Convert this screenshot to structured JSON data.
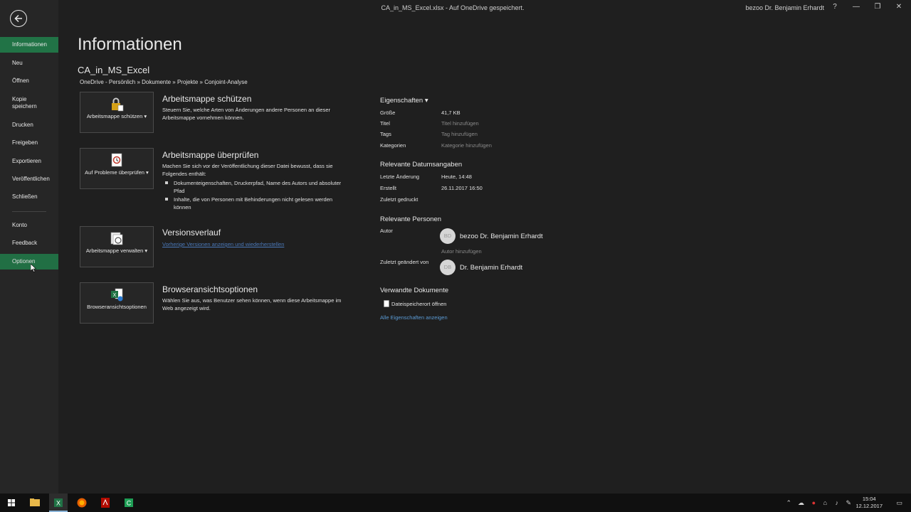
{
  "titlebar": {
    "doc_title": "CA_in_MS_Excel.xlsx - Auf OneDrive gespeichert.",
    "user": "bezoo Dr. Benjamin Erhardt",
    "help": "?",
    "minimize": "—",
    "restore": "❐",
    "close": "✕"
  },
  "sidebar": {
    "items": [
      {
        "label": "Informationen"
      },
      {
        "label": "Neu"
      },
      {
        "label": "Öffnen"
      },
      {
        "label": "Kopie speichern"
      },
      {
        "label": "Drucken"
      },
      {
        "label": "Freigeben"
      },
      {
        "label": "Exportieren"
      },
      {
        "label": "Veröffentlichen"
      },
      {
        "label": "Schließen"
      },
      {
        "label": "Konto"
      },
      {
        "label": "Feedback"
      },
      {
        "label": "Optionen"
      }
    ],
    "active": "Informationen",
    "hover": "Optionen"
  },
  "main": {
    "title": "Informationen",
    "file_name": "CA_in_MS_Excel",
    "path": "OneDrive - Persönlich » Dokumente » Projekte » Conjoint-Analyse",
    "sections": [
      {
        "button": "Arbeitsmappe schützen ▾",
        "title": "Arbeitsmappe schützen",
        "desc": "Steuern Sie, welche Arten von Änderungen andere Personen an dieser Arbeitsmappe vornehmen können."
      },
      {
        "button": "Auf Probleme überprüfen ▾",
        "title": "Arbeitsmappe überprüfen",
        "desc": "Machen Sie sich vor der Veröffentlichung dieser Datei bewusst, dass sie Folgendes enthält:",
        "bullets": [
          "Dokumenteigenschaften, Druckerpfad, Name des Autors und absoluter Pfad",
          "Inhalte, die von Personen mit Behinderungen nicht gelesen werden können"
        ]
      },
      {
        "button": "Arbeitsmappe verwalten ▾",
        "title": "Versionsverlauf",
        "link": "Vorherige Versionen anzeigen und wiederherstellen"
      },
      {
        "button": "Browseransichtsoptionen",
        "title": "Browseransichtsoptionen",
        "desc": "Wählen Sie aus, was Benutzer sehen können, wenn diese Arbeitsmappe im Web angezeigt wird."
      }
    ]
  },
  "properties": {
    "header": "Eigenschaften ▾",
    "size_label": "Größe",
    "size_value": "41,7 KB",
    "title_label": "Titel",
    "title_placeholder": "Titel hinzufügen",
    "tags_label": "Tags",
    "tags_placeholder": "Tag hinzufügen",
    "categories_label": "Kategorien",
    "categories_placeholder": "Kategorie hinzufügen",
    "dates_header": "Relevante Datumsangaben",
    "last_modified_label": "Letzte Änderung",
    "last_modified_value": "Heute, 14:48",
    "created_label": "Erstellt",
    "created_value": "26.11.2017 16:50",
    "last_printed_label": "Zuletzt gedruckt",
    "people_header": "Relevante Personen",
    "author_label": "Autor",
    "author_initials": "BD",
    "author_name": "bezoo Dr. Benjamin Erhardt",
    "add_author": "Autor hinzufügen",
    "last_modified_by_label": "Zuletzt geändert von",
    "modifier_initials": "DB",
    "modifier_name": "Dr. Benjamin Erhardt",
    "related_docs_header": "Verwandte Dokumente",
    "open_file_location": "Dateispeicherort öffnen",
    "show_all": "Alle Eigenschaften anzeigen"
  },
  "taskbar": {
    "time": "15:04",
    "date": "12.12.2017",
    "apps": [
      "windows-start",
      "file-explorer",
      "excel",
      "firefox",
      "acrobat",
      "camtasia"
    ]
  },
  "colors": {
    "accent": "#217346",
    "background": "#1f1f1f",
    "sidebar": "#262626",
    "link": "#5b9bd5"
  }
}
